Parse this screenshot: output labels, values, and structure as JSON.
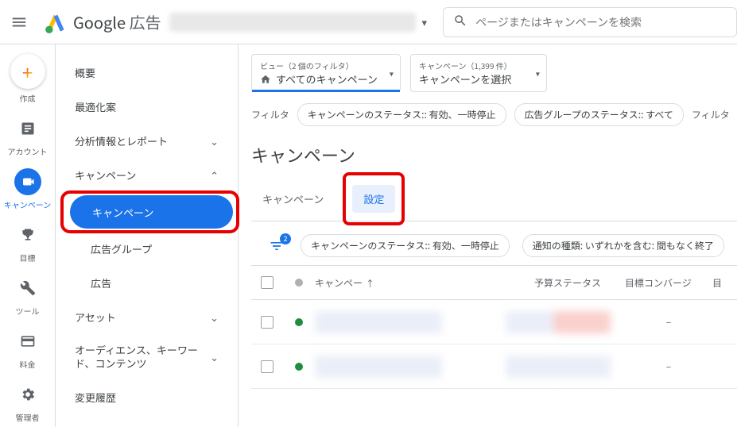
{
  "header": {
    "product_name_bold": "Google",
    "product_name_light": " 広告",
    "search_placeholder": "ページまたはキャンペーンを検索"
  },
  "rail": {
    "create": "作成",
    "account": "アカウント",
    "campaign": "キャンペーン",
    "goal": "目標",
    "tool": "ツール",
    "billing": "料金",
    "manager": "管理者"
  },
  "sidenav": {
    "overview": "概要",
    "recommendations": "最適化案",
    "insights": "分析情報とレポート",
    "campaigns": "キャンペーン",
    "sub_campaigns": "キャンペーン",
    "sub_adgroups": "広告グループ",
    "sub_ads": "広告",
    "assets": "アセット",
    "audiences": "オーディエンス、キーワード、コンテンツ",
    "history": "変更履歴"
  },
  "filters": {
    "view_label": "ビュー（2 個のフィルタ）",
    "view_value": "すべてのキャンペーン",
    "camp_label": "キャンペーン（1,399 件）",
    "camp_value": "キャンペーンを選択",
    "filter_label": "フィルタ",
    "chip_status": "キャンペーンのステータス:: 有効、一時停止",
    "chip_adgroup": "広告グループのステータス:: すべて",
    "chip_more": "フィルタ",
    "funnel_badge": "2",
    "chip_status2": "キャンペーンのステータス:: 有効、一時停止",
    "chip_notif": "通知の種類: いずれかを含む: 間もなく終了"
  },
  "page": {
    "title": "キャンペーン",
    "tab_campaign": "キャンペーン",
    "tab_settings": "設定"
  },
  "table": {
    "col_campaign": "キャンペー",
    "col_budget": "予算",
    "col_status": "ステータス",
    "col_goal": "目標コンバージ",
    "col_more": "目",
    "dash": "–"
  }
}
